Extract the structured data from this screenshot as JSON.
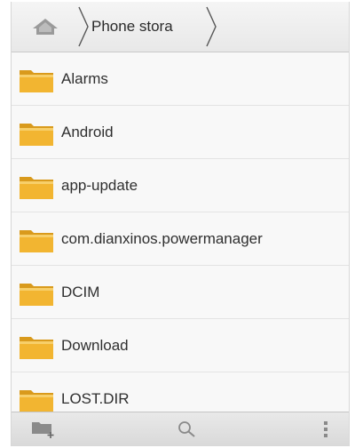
{
  "breadcrumb": {
    "home_icon": "home-icon",
    "current": "Phone stora"
  },
  "files": [
    {
      "name": "Alarms",
      "icon": "folder-icon"
    },
    {
      "name": "Android",
      "icon": "folder-icon"
    },
    {
      "name": "app-update",
      "icon": "folder-icon"
    },
    {
      "name": "com.dianxinos.powermanager",
      "icon": "folder-icon"
    },
    {
      "name": "DCIM",
      "icon": "folder-icon"
    },
    {
      "name": "Download",
      "icon": "folder-icon"
    },
    {
      "name": "LOST.DIR",
      "icon": "folder-icon"
    }
  ],
  "toolbar": {
    "actions": [
      "new-folder-icon",
      "search-icon",
      "overflow-menu-icon"
    ]
  },
  "colors": {
    "folder": "#f2b531",
    "folder_dark": "#d99a1c",
    "icon_gray": "#8a8a8a"
  }
}
